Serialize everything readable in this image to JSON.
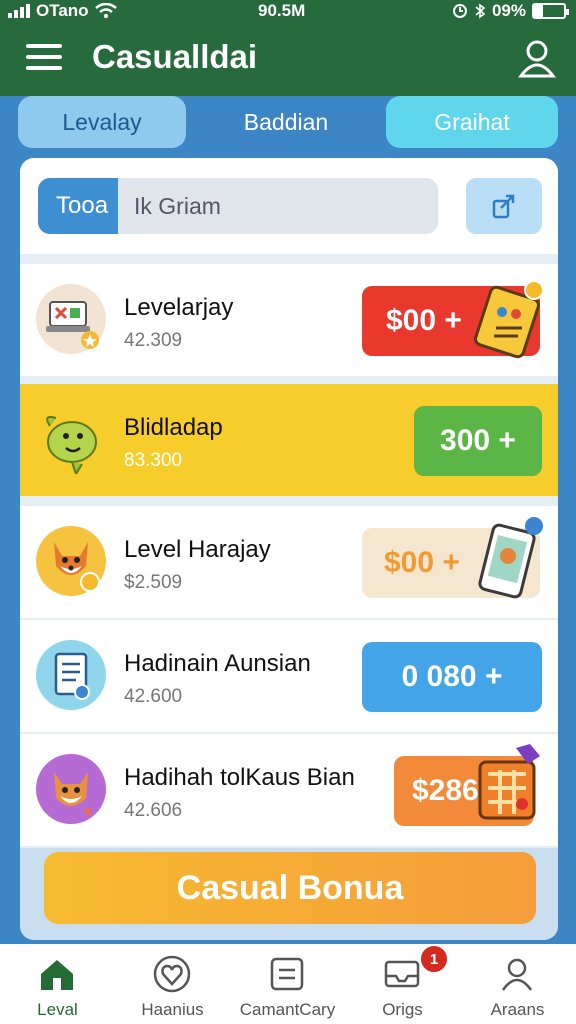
{
  "status_bar": {
    "carrier": "OTano",
    "time": "90.5M",
    "battery": "09%"
  },
  "app_bar": {
    "title": "Casualldai"
  },
  "tabs": [
    {
      "label": "Levalay"
    },
    {
      "label": "Baddian"
    },
    {
      "label": "Graihat"
    }
  ],
  "search": {
    "pill_label": "Tooa",
    "placeholder": "Ik Griam"
  },
  "items": [
    {
      "name": "Levelarjay",
      "sub": "42.309",
      "price": "$00 +",
      "price_color": "#e9392e",
      "icon": "laptop-icon",
      "prize_icon": "gift-card-icon"
    },
    {
      "name": "Blidladap",
      "sub": "83.300",
      "price": "300 +",
      "price_color": "#5bb645",
      "icon": "fish-mascot-icon",
      "prize_icon": ""
    },
    {
      "name": "Level Harajay",
      "sub": "$2.509",
      "price": "$00 +",
      "price_color": "#f5e6cf",
      "icon": "fox-icon",
      "prize_icon": "phone-prize-icon"
    },
    {
      "name": "Hadinain Aunsian",
      "sub": "42.600",
      "price": "0 080 +",
      "price_color": "#43a5e8",
      "icon": "notebook-icon",
      "prize_icon": ""
    },
    {
      "name": "Hadihah tolKaus Bian",
      "sub": "42.606",
      "price": "$286",
      "price_color": "#f28a3a",
      "icon": "dog-icon",
      "prize_icon": "treasure-box-icon"
    }
  ],
  "bonus_button": {
    "label": "Casual Bonua"
  },
  "bottom_nav": [
    {
      "label": "Leval",
      "icon": "home-icon"
    },
    {
      "label": "Haanius",
      "icon": "heart-icon"
    },
    {
      "label": "CamantCary",
      "icon": "list-icon"
    },
    {
      "label": "Origs",
      "icon": "inbox-icon",
      "badge": "1"
    },
    {
      "label": "Araans",
      "icon": "person-icon"
    }
  ],
  "colors": {
    "header": "#276b3c",
    "background": "#3d86c6",
    "highlight_row": "#f6cd2b",
    "active_nav": "#256b35"
  }
}
